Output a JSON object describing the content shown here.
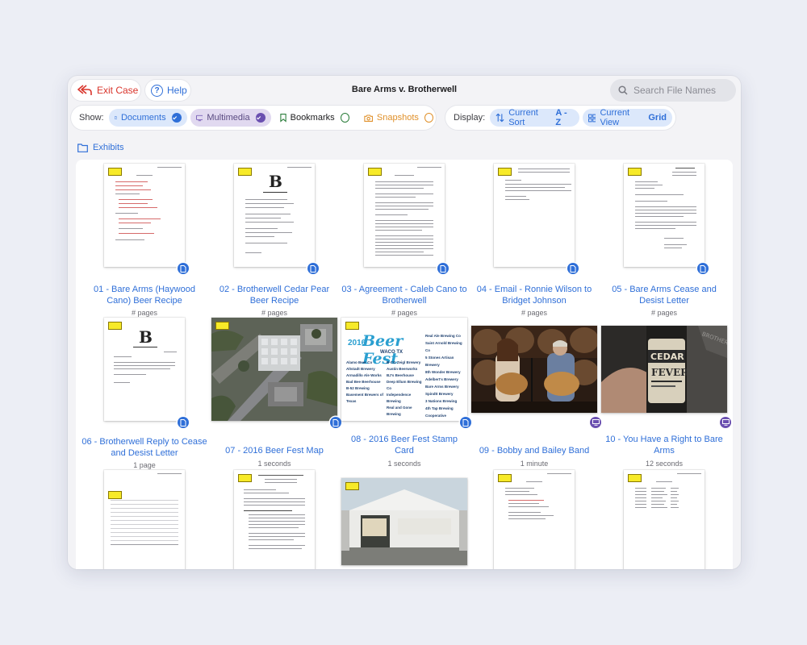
{
  "header": {
    "exit_label": "Exit Case",
    "help_label": "Help",
    "case_title": "Bare Arms v. Brotherwell",
    "search_placeholder": "Search File Names"
  },
  "filters": {
    "show_label": "Show:",
    "documents": {
      "label": "Documents",
      "checked": true
    },
    "multimedia": {
      "label": "Multimedia",
      "checked": true
    },
    "bookmarks": {
      "label": "Bookmarks",
      "checked": false
    },
    "snapshots": {
      "label": "Snapshots",
      "checked": false
    }
  },
  "display": {
    "label": "Display:",
    "sort_label": "Current Sort",
    "sort_value": "A - Z",
    "view_label": "Current View",
    "view_value": "Grid"
  },
  "breadcrumb": {
    "folder": "Exhibits"
  },
  "colors": {
    "accent": "#2f6fd8",
    "exit": "#d9342b",
    "multimedia": "#6a4fb0",
    "bookmarks": "#2a7d3a",
    "snapshots": "#e0902a"
  },
  "files": [
    {
      "title": "01 - Bare Arms (Haywood Cano) Beer Recipe",
      "meta": "# pages",
      "kind": "document"
    },
    {
      "title": "02 - Brotherwell Cedar Pear Beer Recipe",
      "meta": "# pages",
      "kind": "document"
    },
    {
      "title": "03 - Agreement - Caleb Cano to Brotherwell",
      "meta": "# pages",
      "kind": "document"
    },
    {
      "title": "04 - Email - Ronnie Wilson to Bridget Johnson",
      "meta": "# pages",
      "kind": "document"
    },
    {
      "title": "05 - Bare Arms Cease and Desist Letter",
      "meta": "# pages",
      "kind": "document"
    },
    {
      "title": "06 - Brotherwell Reply to Cease and Desist Letter",
      "meta": "1 page",
      "kind": "document"
    },
    {
      "title": "07 - 2016 Beer Fest Map",
      "meta": "1 seconds",
      "kind": "document"
    },
    {
      "title": "08 - 2016 Beer Fest Stamp Card",
      "meta": "1 seconds",
      "kind": "document"
    },
    {
      "title": "09 - Bobby and Bailey Band",
      "meta": "1 minute",
      "kind": "multimedia"
    },
    {
      "title": "10 - You Have a Right to Bare Arms",
      "meta": "12 seconds",
      "kind": "multimedia"
    },
    {
      "title": "",
      "meta": "",
      "kind": "document"
    },
    {
      "title": "",
      "meta": "",
      "kind": "document"
    },
    {
      "title": "",
      "meta": "",
      "kind": "document"
    },
    {
      "title": "",
      "meta": "",
      "kind": "document"
    },
    {
      "title": "",
      "meta": "",
      "kind": "document"
    }
  ],
  "thumb_text": {
    "beerfest_title": "Beer Fest",
    "beerfest_year": "2016",
    "beerfest_city": "WACO TX",
    "beerfest_left": [
      "Alamo Beer Co",
      "Altstadt Brewery",
      "Armadillo Ale Works",
      "Bad Bee Beerhouse",
      "B-52 Brewing",
      "Basement Brewers of Texas"
    ],
    "beerfest_mid": [
      "B-CG Zeigl Brewery",
      "Austin Beerworks",
      "BJ's Beerhouse",
      "Deep Ellum Brewing Co",
      "Independence Brewing",
      "Real and Gone Brewing"
    ],
    "beerfest_right": [
      "Real Ale Brewing Co",
      "Saint Arnold Brewing Co",
      "5 Stones Artisan Brewery",
      "8th Wonder Brewery",
      "Adelbert's Brewery",
      "Bare Arms Brewery",
      "Spindtt Brewery",
      "3 Nations Brewing",
      "4th Tap Brewing Cooperative"
    ],
    "fever_label": "FEVER",
    "cedar_label": "CEDAR",
    "brotherwell_label": "BROTHERWELL"
  }
}
